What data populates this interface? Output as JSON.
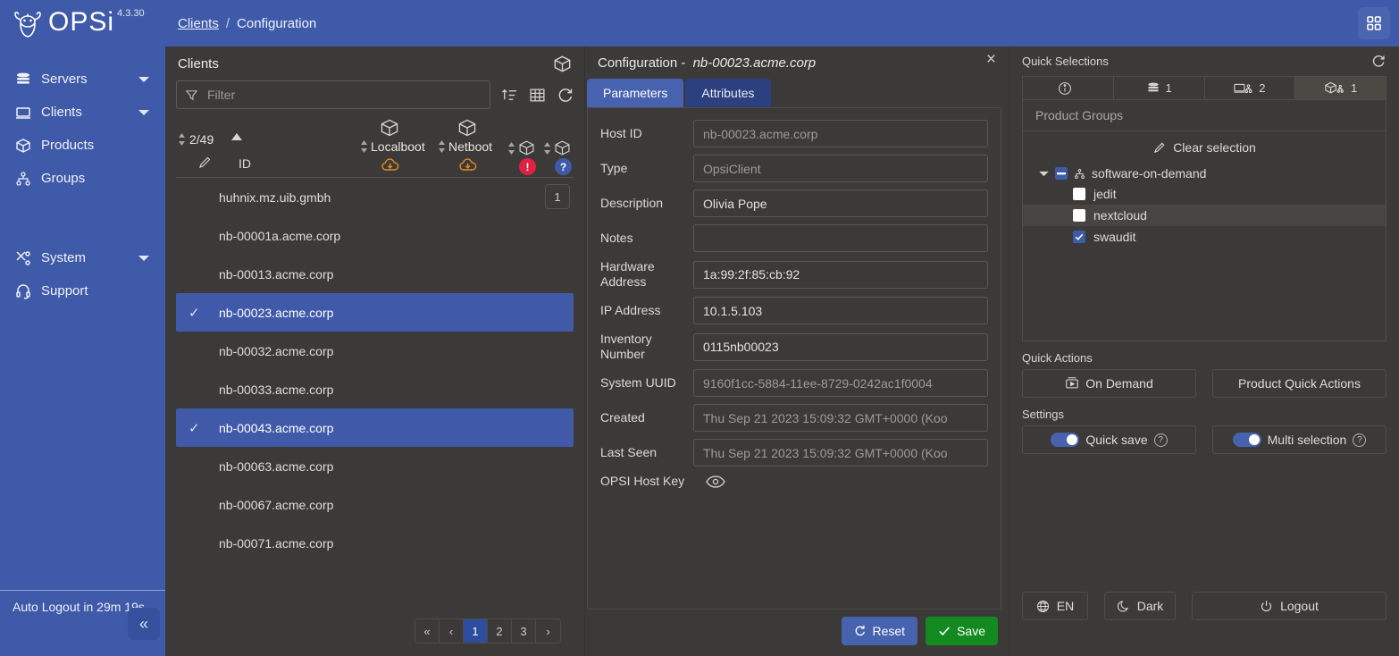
{
  "header": {
    "brand": "OPSi",
    "version": "4.3.30",
    "breadcrumb_link": "Clients",
    "breadcrumb_sep": "/",
    "breadcrumb_current": "Configuration",
    "grid_icon": "grid-apps-icon"
  },
  "sidebar": {
    "items": [
      {
        "label": "Servers",
        "icon": "database-icon",
        "has_chevron": true
      },
      {
        "label": "Clients",
        "icon": "monitor-icon",
        "has_chevron": true
      },
      {
        "label": "Products",
        "icon": "box-icon",
        "has_chevron": false
      },
      {
        "label": "Groups",
        "icon": "group-tree-icon",
        "has_chevron": false
      },
      {
        "label": "System",
        "icon": "tools-icon",
        "has_chevron": true
      },
      {
        "label": "Support",
        "icon": "headset-icon",
        "has_chevron": false
      }
    ],
    "auto_logout": "Auto Logout in 29m 19s",
    "collapse_label": "«"
  },
  "clients": {
    "title": "Clients",
    "box_icon": "box-icon",
    "filter_placeholder": "Filter",
    "filter_value": "",
    "toolbar_icons": [
      "sort-icon",
      "table-columns-icon",
      "refresh-icon"
    ],
    "columns": {
      "count": "2/49",
      "id": "ID",
      "localboot": "Localboot",
      "netboot": "Netboot",
      "badge_error": "!",
      "badge_unknown": "?"
    },
    "rows": [
      {
        "id": "huhnix.mz.uib.gmbh",
        "selected": false,
        "count": "1"
      },
      {
        "id": "nb-00001a.acme.corp",
        "selected": false,
        "count": ""
      },
      {
        "id": "nb-00013.acme.corp",
        "selected": false,
        "count": ""
      },
      {
        "id": "nb-00023.acme.corp",
        "selected": true,
        "count": ""
      },
      {
        "id": "nb-00032.acme.corp",
        "selected": false,
        "count": ""
      },
      {
        "id": "nb-00033.acme.corp",
        "selected": false,
        "count": ""
      },
      {
        "id": "nb-00043.acme.corp",
        "selected": true,
        "count": ""
      },
      {
        "id": "nb-00063.acme.corp",
        "selected": false,
        "count": ""
      },
      {
        "id": "nb-00067.acme.corp",
        "selected": false,
        "count": ""
      },
      {
        "id": "nb-00071.acme.corp",
        "selected": false,
        "count": ""
      }
    ],
    "pagination": {
      "first": "«",
      "prev": "‹",
      "next": "›",
      "pages": [
        "1",
        "2",
        "3"
      ],
      "active": "1"
    }
  },
  "configuration": {
    "title_prefix": "Configuration -",
    "title_host": "nb-00023.acme.corp",
    "close_label": "×",
    "tabs": [
      {
        "label": "Parameters",
        "active": true
      },
      {
        "label": "Attributes",
        "active": false
      }
    ],
    "fields": [
      {
        "label": "Host ID",
        "value": "nb-00023.acme.corp",
        "disabled": true
      },
      {
        "label": "Type",
        "value": "OpsiClient",
        "disabled": true
      },
      {
        "label": "Description",
        "value": "Olivia Pope",
        "disabled": false
      },
      {
        "label": "Notes",
        "value": "",
        "disabled": false
      },
      {
        "label": "Hardware Address",
        "value": "1a:99:2f:85:cb:92",
        "disabled": false
      },
      {
        "label": "IP Address",
        "value": "10.1.5.103",
        "disabled": false
      },
      {
        "label": "Inventory Number",
        "value": "0115nb00023",
        "disabled": false
      },
      {
        "label": "System UUID",
        "value": "9160f1cc-5884-11ee-8729-0242ac1f0004",
        "disabled": true
      },
      {
        "label": "Created",
        "value": "Thu Sep 21 2023 15:09:32 GMT+0000 (Koo",
        "disabled": true
      },
      {
        "label": "Last Seen",
        "value": "Thu Sep 21 2023 15:09:32 GMT+0000 (Koo",
        "disabled": true
      }
    ],
    "host_key_label": "OPSI Host Key",
    "host_key_icon": "eye-icon",
    "reset_label": "Reset",
    "save_label": "Save"
  },
  "quick_selections": {
    "title": "Quick Selections",
    "refresh_icon": "refresh-icon",
    "tabs": [
      {
        "icon": "info-icon",
        "count": "",
        "active": false
      },
      {
        "icon": "database-icon",
        "count": "1",
        "active": false
      },
      {
        "icon": "monitor-group-icon",
        "count": "2",
        "active": false
      },
      {
        "icon": "box-group-icon",
        "count": "1",
        "active": true
      }
    ],
    "group_label": "Product Groups",
    "clear_selection": "Clear selection",
    "tree": {
      "root": {
        "label": "software-on-demand",
        "state": "indeterminate",
        "expanded": true
      },
      "children": [
        {
          "label": "jedit",
          "checked": false,
          "hovered": false
        },
        {
          "label": "nextcloud",
          "checked": false,
          "hovered": true
        },
        {
          "label": "swaudit",
          "checked": true,
          "hovered": false
        }
      ]
    }
  },
  "quick_actions": {
    "title": "Quick Actions",
    "on_demand": "On Demand",
    "product_quick_actions": "Product Quick Actions"
  },
  "settings": {
    "title": "Settings",
    "quick_save": "Quick save",
    "multi_selection": "Multi selection",
    "quick_save_on": true,
    "multi_selection_on": true
  },
  "footer": {
    "language": "EN",
    "theme": "Dark",
    "logout": "Logout"
  },
  "colors": {
    "brand_blue": "#3f5aa8",
    "accent_blue": "#4762ae",
    "selected_row": "#4059a9",
    "save_green": "#128a20",
    "error_red": "#e02040",
    "cloud_orange": "#e28b20",
    "panel_bg": "#3c3a38"
  }
}
